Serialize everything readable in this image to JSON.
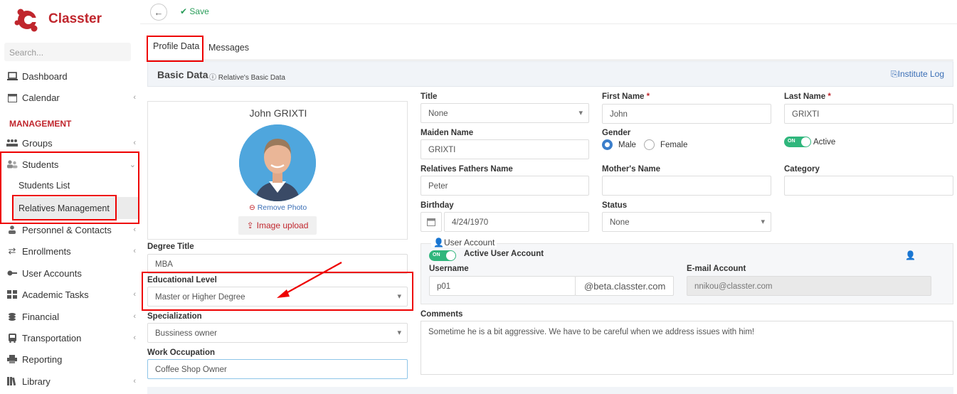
{
  "brand": {
    "name": "Classter"
  },
  "sidebar": {
    "search_placeholder": "Search...",
    "section_label": "MANAGEMENT",
    "items": [
      {
        "label": "Dashboard"
      },
      {
        "label": "Calendar"
      },
      {
        "label": "Groups"
      },
      {
        "label": "Students"
      },
      {
        "label": "Personnel & Contacts"
      },
      {
        "label": "Enrollments"
      },
      {
        "label": "User Accounts"
      },
      {
        "label": "Academic Tasks"
      },
      {
        "label": "Financial"
      },
      {
        "label": "Transportation"
      },
      {
        "label": "Reporting"
      },
      {
        "label": "Library"
      }
    ],
    "sub_items": [
      {
        "label": "Students List"
      },
      {
        "label": "Relatives Management"
      }
    ]
  },
  "toolbar": {
    "save_label": "Save"
  },
  "tabs": [
    {
      "label": "Profile Data"
    },
    {
      "label": "Messages"
    }
  ],
  "panel": {
    "title": "Basic Data",
    "subtitle": "Relative's Basic Data",
    "log_label": "Institute Log"
  },
  "profile": {
    "name": "John GRIXTI",
    "remove_photo": "Remove Photo",
    "upload_label": "Image upload"
  },
  "left_form": {
    "degree_title": {
      "label": "Degree Title",
      "value": "MBA"
    },
    "educational_level": {
      "label": "Educational Level",
      "value": "Master or Higher Degree"
    },
    "specialization": {
      "label": "Specialization",
      "value": "Bussiness owner"
    },
    "work_occupation": {
      "label": "Work Occupation",
      "value": "Coffee Shop Owner"
    }
  },
  "form": {
    "title": {
      "label": "Title",
      "value": "None"
    },
    "first_name": {
      "label": "First Name",
      "required": "*",
      "value": "John"
    },
    "last_name": {
      "label": "Last Name",
      "required": "*",
      "value": "GRIXTI"
    },
    "maiden_name": {
      "label": "Maiden Name",
      "value": "GRIXTI"
    },
    "gender": {
      "label": "Gender",
      "options": [
        "Male",
        "Female"
      ],
      "selected": "Male"
    },
    "active": {
      "toggle_text": "ON",
      "label": "Active"
    },
    "fathers_name": {
      "label": "Relatives Fathers Name",
      "value": "Peter"
    },
    "mothers_name": {
      "label": "Mother's Name",
      "value": ""
    },
    "category": {
      "label": "Category",
      "value": ""
    },
    "birthday": {
      "label": "Birthday",
      "value": "4/24/1970"
    },
    "status": {
      "label": "Status",
      "value": "None"
    }
  },
  "user_account": {
    "title": "User Account",
    "toggle_text": "ON",
    "active_label": "Active User Account",
    "username_label": "Username",
    "username_value": "p01",
    "domain": "@beta.classter.com",
    "email_label": "E-mail Account",
    "email_value": "nnikou@classter.com"
  },
  "comments": {
    "label": "Comments",
    "value": "Sometime he is a bit aggressive. We have to be careful when we address issues with him!"
  },
  "colors": {
    "brand": "#c0262d",
    "accent": "#3b6fb6",
    "toggle": "#2fb67c",
    "highlight": "#ee0000"
  }
}
